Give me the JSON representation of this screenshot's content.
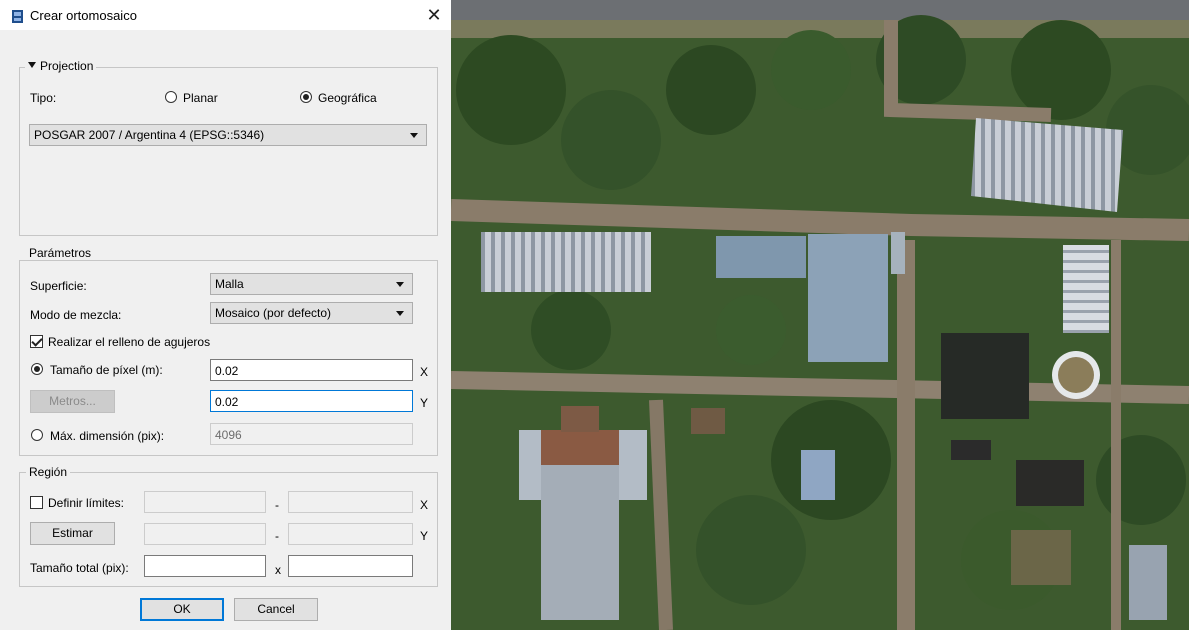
{
  "window": {
    "title": "Crear ortomosaico"
  },
  "projection": {
    "legend": "Projection",
    "tipo_label": "Tipo:",
    "planar_label": "Planar",
    "geografica_label": "Geográfica",
    "selected": "Geográfica",
    "crs_value": "POSGAR 2007 / Argentina 4 (EPSG::5346)"
  },
  "parametros": {
    "legend": "Parámetros",
    "superficie_label": "Superficie:",
    "superficie_value": "Malla",
    "mezcla_label": "Modo de mezcla:",
    "mezcla_value": "Mosaico (por defecto)",
    "relleno_label": "Realizar el relleno de agujeros",
    "relleno_checked": true,
    "pixel_label": "Tamaño de píxel (m):",
    "pixel_x": "0.02",
    "pixel_y": "0.02",
    "metros_button": "Metros...",
    "maxdim_label": "Máx. dimensión (pix):",
    "maxdim_value": "4096",
    "axis_x": "X",
    "axis_y": "Y"
  },
  "region": {
    "legend": "Región",
    "definir_label": "Definir límites:",
    "definir_checked": false,
    "estimar_button": "Estimar",
    "dash": "-",
    "axis_x": "X",
    "axis_y": "Y",
    "total_label": "Tamaño total (pix):",
    "total_x_sep": "x"
  },
  "buttons": {
    "ok": "OK",
    "cancel": "Cancel"
  },
  "image": {
    "description_icon": "aerial-orthomosaic-image"
  }
}
